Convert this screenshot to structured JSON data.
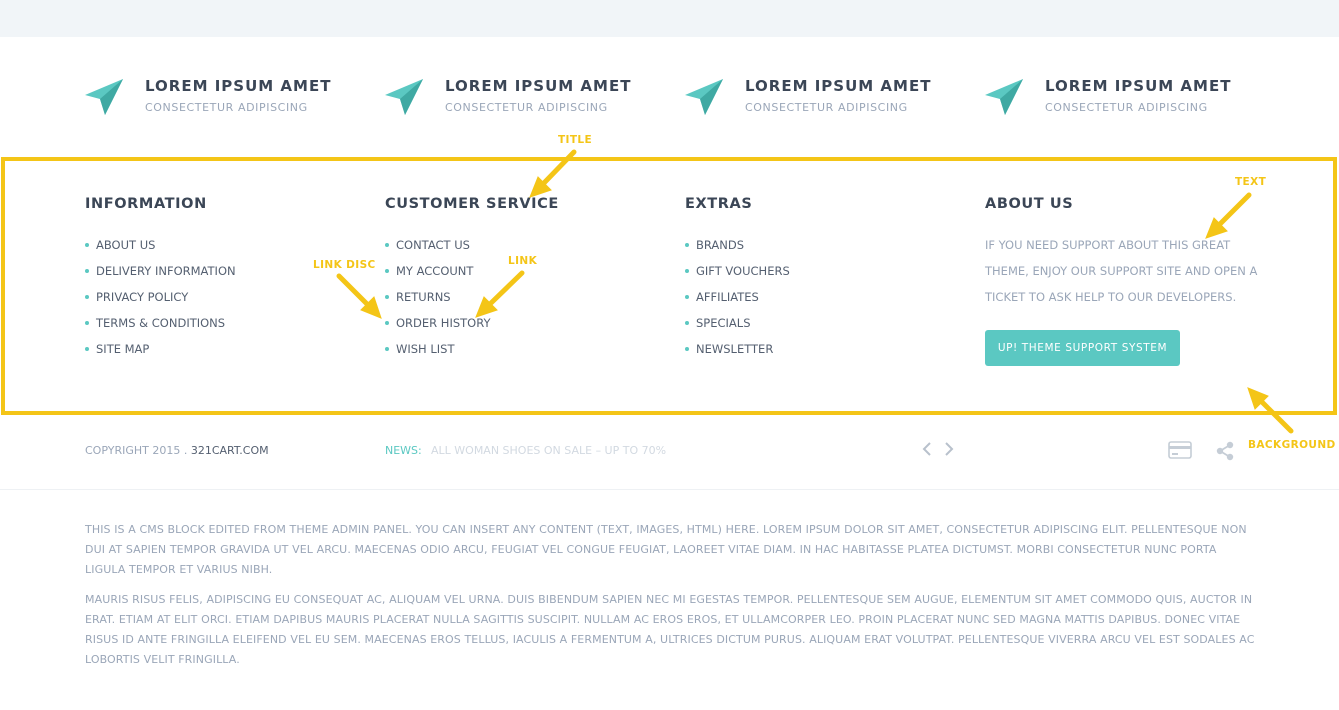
{
  "features": [
    {
      "icon": "paper-plane-icon",
      "title": "LOREM IPSUM AMET",
      "subtitle": "CONSECTETUR ADIPISCING"
    },
    {
      "icon": "paper-plane-icon",
      "title": "LOREM IPSUM AMET",
      "subtitle": "CONSECTETUR ADIPISCING"
    },
    {
      "icon": "paper-plane-icon",
      "title": "LOREM IPSUM AMET",
      "subtitle": "CONSECTETUR ADIPISCING"
    },
    {
      "icon": "paper-plane-icon",
      "title": "LOREM IPSUM AMET",
      "subtitle": "CONSECTETUR ADIPISCING"
    }
  ],
  "footer": {
    "information": {
      "title": "INFORMATION",
      "links": [
        "ABOUT US",
        "DELIVERY INFORMATION",
        "PRIVACY POLICY",
        "TERMS & CONDITIONS",
        "SITE MAP"
      ]
    },
    "customer_service": {
      "title": "CUSTOMER SERVICE",
      "links": [
        "CONTACT US",
        "MY ACCOUNT",
        "RETURNS",
        "ORDER HISTORY",
        "WISH LIST"
      ]
    },
    "extras": {
      "title": "EXTRAS",
      "links": [
        "BRANDS",
        "GIFT VOUCHERS",
        "AFFILIATES",
        "SPECIALS",
        "NEWSLETTER"
      ]
    },
    "about": {
      "title": "ABOUT US",
      "text": "IF YOU NEED SUPPORT ABOUT THIS GREAT THEME, ENJOY OUR SUPPORT SITE AND OPEN A TICKET TO ASK HELP TO OUR DEVELOPERS.",
      "button": "UP! THEME SUPPORT SYSTEM"
    }
  },
  "annotations": {
    "title": "TITLE",
    "text": "TEXT",
    "link_disc": "LINK DISC",
    "link": "LINK",
    "background": "BACKGROUND",
    "color": "#f4c517"
  },
  "bottom": {
    "copyright_prefix": "COPYRIGHT 2015 .",
    "copyright_site": "321CART.COM",
    "news_label": "NEWS:",
    "news_text": "ALL WOMAN SHOES ON SALE – UP TO 70%",
    "icons": [
      "chevron-left-icon",
      "chevron-right-icon",
      "credit-card-icon",
      "share-icon"
    ]
  },
  "cms": {
    "paragraphs": [
      "THIS IS A CMS BLOCK EDITED FROM THEME ADMIN PANEL. YOU CAN INSERT ANY CONTENT (TEXT, IMAGES, HTML) HERE. LOREM IPSUM DOLOR SIT AMET, CONSECTETUR ADIPISCING ELIT. PELLENTESQUE NON DUI AT SAPIEN TEMPOR GRAVIDA UT VEL ARCU. MAECENAS ODIO ARCU, FEUGIAT VEL CONGUE FEUGIAT, LAOREET VITAE DIAM. IN HAC HABITASSE PLATEA DICTUMST. MORBI CONSECTETUR NUNC PORTA LIGULA TEMPOR ET VARIUS NIBH.",
      "MAURIS RISUS FELIS, ADIPISCING EU CONSEQUAT AC, ALIQUAM VEL URNA. DUIS BIBENDUM SAPIEN NEC MI EGESTAS TEMPOR. PELLENTESQUE SEM AUGUE, ELEMENTUM SIT AMET COMMODO QUIS, AUCTOR IN ERAT. ETIAM AT ELIT ORCI. ETIAM DAPIBUS MAURIS PLACERAT NULLA SAGITTIS SUSCIPIT. NULLAM AC EROS EROS, ET ULLAMCORPER LEO. PROIN PLACERAT NUNC SED MAGNA MATTIS DAPIBUS. DONEC VITAE RISUS ID ANTE FRINGILLA ELEIFEND VEL EU SEM. MAECENAS EROS TELLUS, IACULIS A FERMENTUM A, ULTRICES DICTUM PURUS. ALIQUAM ERAT VOLUTPAT. PELLENTESQUE VIVERRA ARCU VEL EST SODALES AC LOBORTIS VELIT FRINGILLA."
    ]
  },
  "colors": {
    "accent": "#5bc8c2",
    "highlight": "#f4c517",
    "top_band": "#f1f5f8"
  }
}
